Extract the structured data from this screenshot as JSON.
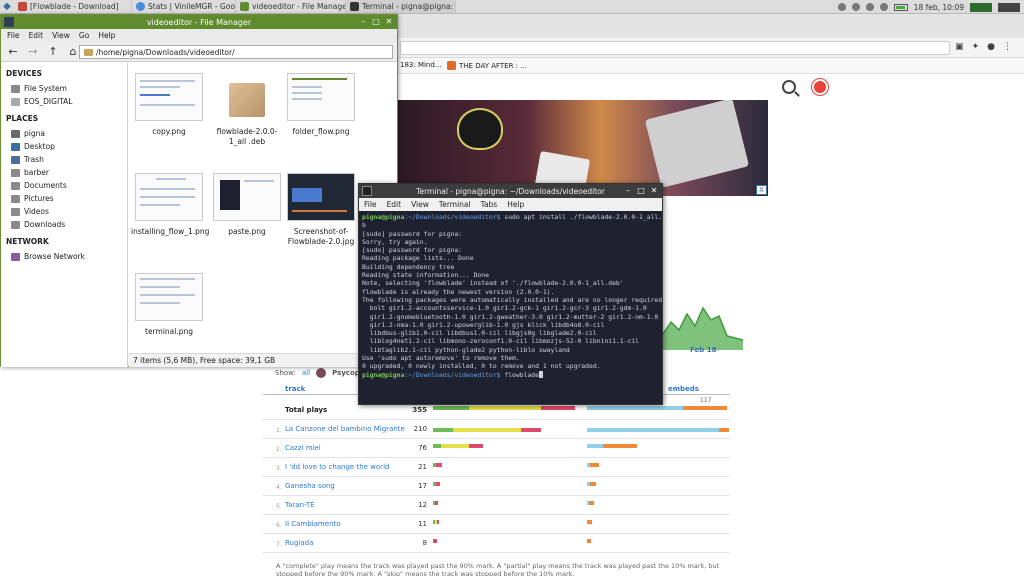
{
  "panel": {
    "tasks": [
      {
        "label": "[Flowblade - Download]",
        "color": "#c04a3a"
      },
      {
        "label": "Stats | VinileMGR - Googl...",
        "color": "#4a8ae0"
      },
      {
        "label": "videoeditor - File Manager",
        "color": "#5f8a2d"
      },
      {
        "label": "Terminal - pigna@pigna: ...",
        "color": "#333333"
      }
    ],
    "clock": "18 feb, 10:09"
  },
  "browser": {
    "bookmarks": [
      {
        "label": "183: Mind...",
        "color": "#c04a3a"
      },
      {
        "label": "THE DAY AFTER : ...",
        "color": "#e06a2a"
      }
    ],
    "show_label": "Show:",
    "show_all": "all",
    "show_user": "Psycopa",
    "col_track": "track",
    "col_embeds": "embeds",
    "max_value": "117",
    "chart_date": "Feb 18",
    "ad_close": "X",
    "rows": [
      {
        "idx": "",
        "name": "Total plays",
        "num": "355",
        "bold": true
      },
      {
        "idx": "1.",
        "name": "La Canzone del bambino Migrante",
        "num": "210"
      },
      {
        "idx": "2.",
        "name": "Cazzi miei",
        "num": "76"
      },
      {
        "idx": "3.",
        "name": "I 'dd love to change the world",
        "num": "21"
      },
      {
        "idx": "4.",
        "name": "Ganesha song",
        "num": "17"
      },
      {
        "idx": "5.",
        "name": "Taran-TÈ",
        "num": "12"
      },
      {
        "idx": "6.",
        "name": "Il Cambiamento",
        "num": "11"
      },
      {
        "idx": "7.",
        "name": "Rugiada",
        "num": "8"
      }
    ],
    "footer": "A \"complete\" play means the track was played past the 90% mark. A \"partial\" play means the track was played past the 10% mark, but stopped before the 90% mark. A \"skip\" means the track was stopped before the 10% mark."
  },
  "file_manager": {
    "title": "videoeditor - File Manager",
    "menu": [
      "File",
      "Edit",
      "View",
      "Go",
      "Help"
    ],
    "path": "/home/pigna/Downloads/videoeditor/",
    "sections": {
      "devices": "DEVICES",
      "places": "PLACES",
      "network": "NETWORK"
    },
    "devices": [
      "File System",
      "EOS_DIGITAL"
    ],
    "places": [
      "pigna",
      "Desktop",
      "Trash",
      "barber",
      "Documents",
      "Pictures",
      "Videos",
      "Downloads"
    ],
    "network": [
      "Browse Network"
    ],
    "files": [
      {
        "name": "copy.png"
      },
      {
        "name": "flowblade-2.0.0-1_all .deb"
      },
      {
        "name": "folder_flow.png"
      },
      {
        "name": "installing_flow_1.png"
      },
      {
        "name": "paste.png"
      },
      {
        "name": "Screenshot-of- Flowblade-2.0.jpg"
      },
      {
        "name": "terminal.png"
      }
    ],
    "status": "7 items (5,6 MB), Free space: 39,1 GB"
  },
  "terminal": {
    "title": "Terminal - pigna@pigna: ~/Downloads/videoeditor",
    "menu": [
      "File",
      "Edit",
      "View",
      "Terminal",
      "Tabs",
      "Help"
    ],
    "prompt_user": "pigna@pigna",
    "prompt_path": ":~/Downloads/videoeditor$",
    "command1": " sudo apt install ./flowblade-2.0.0-1_all.de\nb",
    "output": "[sudo] password for pigna:\nSorry, try again.\n[sudo] password for pigna:\nReading package lists... Done\nBuilding dependency tree\nReading state information... Done\nNote, selecting 'flowblade' instead of './flowblade-2.0.0-1_all.deb'\nflowblade is already the newest version (2.0.0-1).\nThe following packages were automatically installed and are no longer required:\n  bolt gir1.2-accountsservice-1.0 gir1.2-gck-1 gir1.2-gcr-3 gir1.2-gdm-1.0\n  gir1.2-gnomebluetooth-1.0 gir1.2-gweather-3.0 gir1.2-mutter-2 gir1.2-nm-1.0\n  gir1.2-nma-1.0 gir1.2-upowerglib-1.0 gjs klick libdb4o8.0-cil\n  libdbus-glib1.0-cil libdbus1.0-cil libgjs0g libglade2.0-cil\n  liblog4net1.2-cil libmono-zeroconf1.0-cil libmozjs-52-0 libnini1.1-cil\n  libtaglib2.1-cil python-glade2 python-liblo xwayland\nUse 'sudo apt autoremove' to remove them.\n0 upgraded, 0 newly installed, 0 to remove and 1 not upgraded.",
    "command2": " flowblade"
  }
}
